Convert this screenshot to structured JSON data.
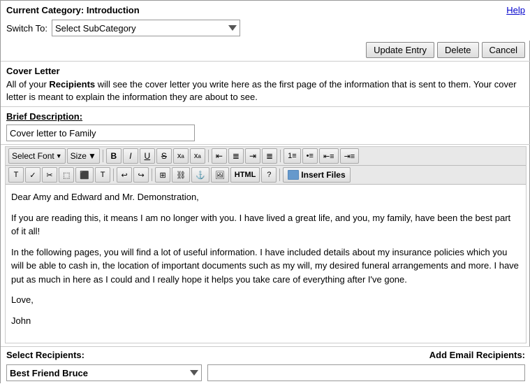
{
  "header": {
    "category_prefix": "Current Category:",
    "category_name": "Introduction",
    "help_label": "Help"
  },
  "switch_to": {
    "label": "Switch To:",
    "placeholder": "Select SubCategory",
    "options": [
      "Select SubCategory"
    ]
  },
  "actions": {
    "update_label": "Update Entry",
    "delete_label": "Delete",
    "cancel_label": "Cancel"
  },
  "cover_letter": {
    "title": "Cover Letter",
    "description_part1": "All of your ",
    "description_bold": "Recipients",
    "description_part2": " will see the cover letter you write here as the first page of the information that is sent to them. Your cover letter is meant to explain the information they are about to see."
  },
  "brief_description": {
    "label": "Brief Description:",
    "value": "Cover letter to Family"
  },
  "toolbar": {
    "font_select": "Select Font",
    "size_label": "Size",
    "bold": "B",
    "italic": "I",
    "underline": "U",
    "strikethrough": "S",
    "subscript": "x",
    "superscript": "x",
    "align_left": "≡",
    "align_center": "≡",
    "align_right": "≡",
    "align_justify": "≡",
    "list_ol": "≡",
    "list_ul": "≡",
    "indent": "≡",
    "outdent": "≡",
    "html_label": "HTML",
    "insert_files": "Insert Files"
  },
  "editor_content": {
    "line1": "Dear Amy and Edward and Mr. Demonstration,",
    "line2": "If you are reading this, it means I am no longer with you. I have lived a great life, and you, my family, have been the best part of it all!",
    "line3": "In the following pages, you will find a lot of useful information. I have included details about my insurance policies which you will be able to cash in, the location of important documents such as my will, my desired funeral arrangements and more. I have put as much in here as I could and I really hope it helps you take care of everything after I've gone.",
    "line4": "Love,",
    "line5": "John"
  },
  "recipients": {
    "label": "Select Recipients:",
    "selected": "Best Friend Bruce",
    "add_email_label": "Add Email Recipients:"
  }
}
